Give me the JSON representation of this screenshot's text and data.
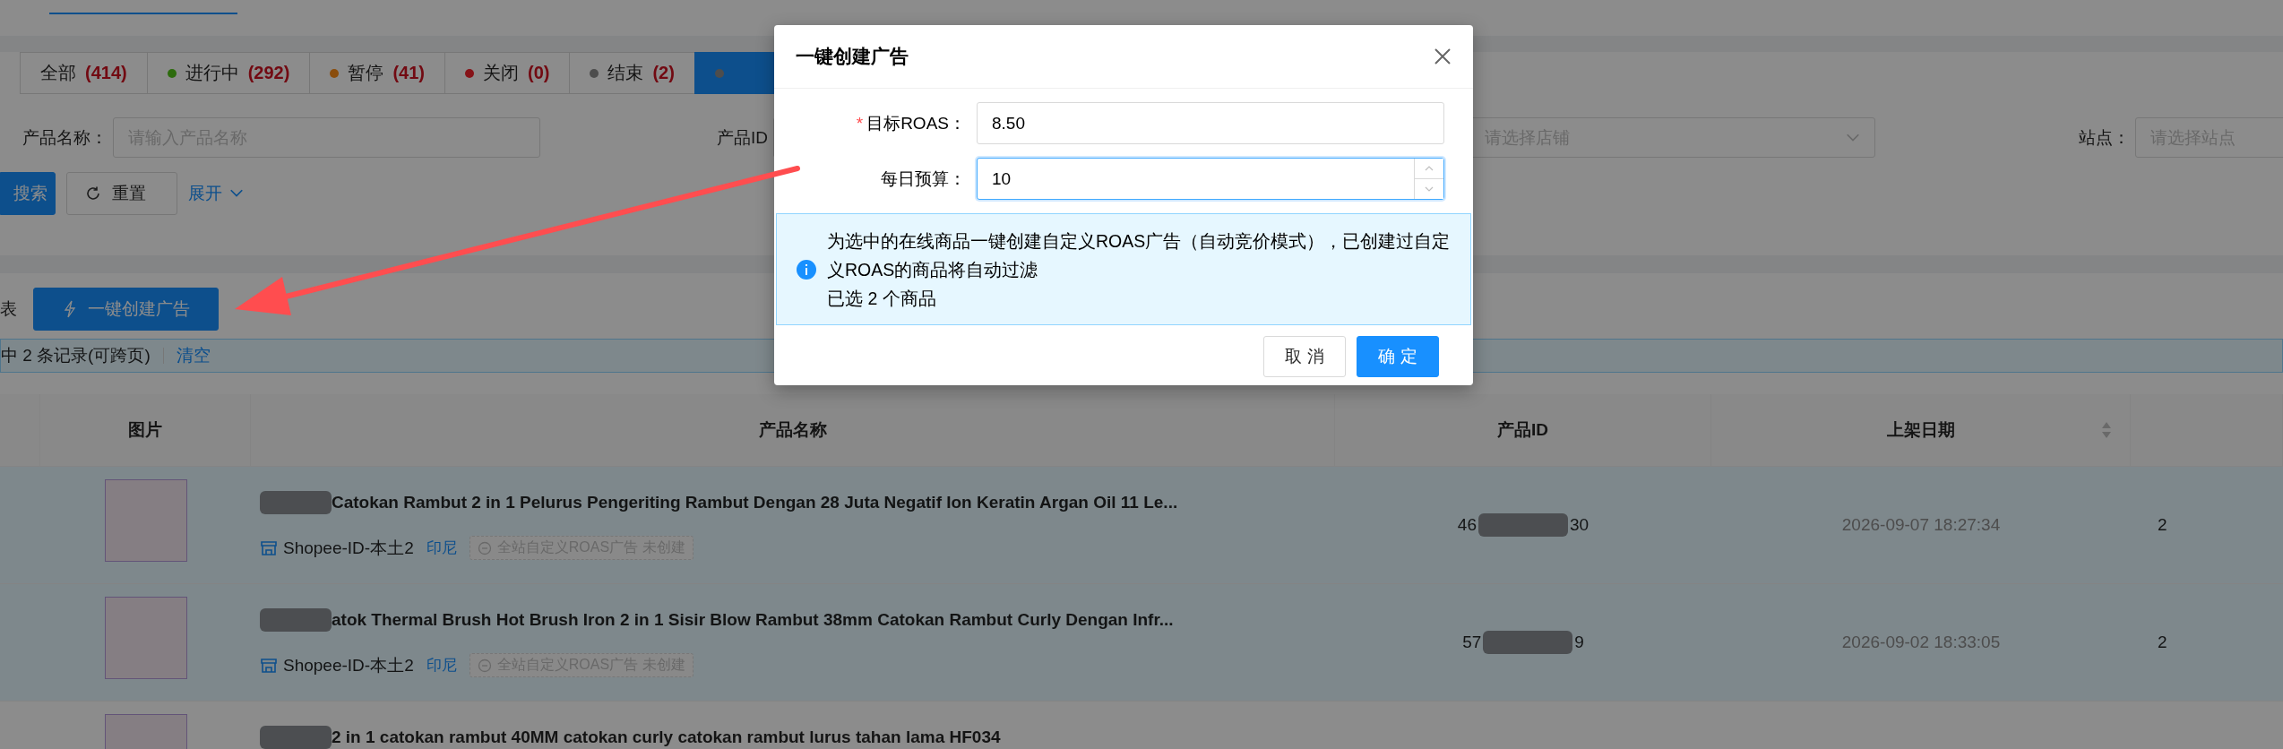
{
  "status_tabs": [
    {
      "label": "全部",
      "count": "(414)",
      "selected": false
    },
    {
      "label": "进行中",
      "count": "(292)",
      "color": "#2d6c0e",
      "selected": false
    },
    {
      "label": "暂停",
      "count": "(41)",
      "color": "#8a4d0c",
      "selected": false
    },
    {
      "label": "关闭",
      "count": "(0)",
      "color": "#871319",
      "selected": false
    },
    {
      "label": "结束",
      "count": "(2)",
      "color": "#4d4d4d",
      "selected": false
    },
    {
      "color": "#4d4d4d",
      "selected": true
    }
  ],
  "filters": [
    {
      "kind": "input",
      "label": "产品名称：",
      "placeholder": "请输入产品名称"
    },
    {
      "kind": "input",
      "label": "产品ID"
    },
    {
      "kind": "select",
      "placeholder": "请选择店铺"
    },
    {
      "kind": "select",
      "label": "站点：",
      "placeholder": "请选择站点"
    }
  ],
  "filter_actions": {
    "search": "搜索",
    "reset": "重置",
    "expand": "展开"
  },
  "list": {
    "title_fragment": "表",
    "create_button": "一键创建广告",
    "selection_text": "中 2 条记录(可跨页)",
    "clear_link": "清空"
  },
  "table": {
    "columns": [
      {
        "label": "图片",
        "sortable": false
      },
      {
        "label": "产品名称",
        "sortable": false
      },
      {
        "label": "产品ID",
        "sortable": false
      },
      {
        "label": "上架日期",
        "sortable": true
      }
    ],
    "rows": [
      {
        "selected": true,
        "title": "Catokan Rambut 2 in 1 Pelurus Pengeriting Rambut Dengan 28 Juta Negatif Ion Keratin Argan Oil 11 Le...",
        "shop": "Shopee-ID-本土2",
        "region": "印尼",
        "ad_status": "全站自定义ROAS广告 未创建",
        "product_id": [
          "46",
          "30"
        ],
        "listed_at": "2026-09-07 18:27:34",
        "column_6": "2"
      },
      {
        "selected": true,
        "title": "atok Thermal Brush Hot Brush Iron 2 in 1 Sisir Blow Rambut 38mm Catokan Rambut Curly Dengan Infr...",
        "shop": "Shopee-ID-本土2",
        "region": "印尼",
        "ad_status": "全站自定义ROAS广告 未创建",
        "product_id": [
          "57",
          "9"
        ],
        "listed_at": "2026-09-02 18:33:05",
        "column_6": "2"
      },
      {
        "selected": false,
        "title": "2 in 1 catokan rambut 40MM catokan curly catokan rambut lurus tahan lama HF034"
      }
    ]
  },
  "modal": {
    "title": "一键创建广告",
    "fields": [
      {
        "kind": "text",
        "required_mark": "*",
        "label": "目标ROAS：",
        "value": "8.50",
        "focused": false
      },
      {
        "kind": "number",
        "label": "每日预算：",
        "value": "10",
        "focused": true
      }
    ],
    "notice": [
      "为选中的在线商品一键创建自定义ROAS广告（自动竞价模式），已创建过自定义ROAS的商品将自动过滤",
      "已选 2 个商品"
    ],
    "buttons": [
      {
        "kind": "default",
        "label": "取 消"
      },
      {
        "kind": "primary",
        "label": "确 定"
      }
    ]
  }
}
